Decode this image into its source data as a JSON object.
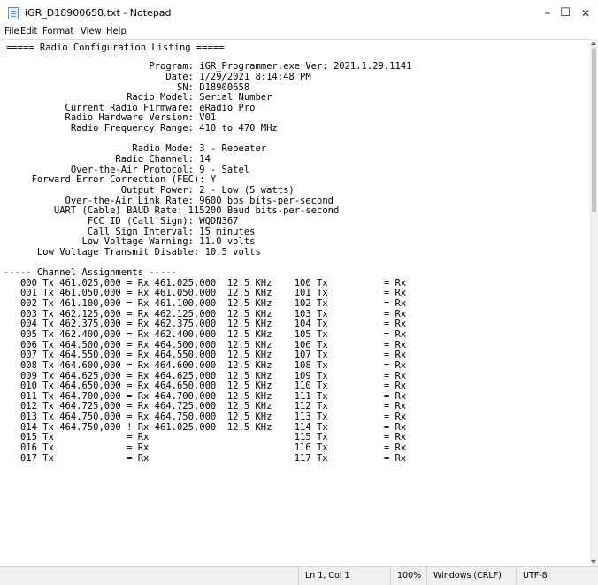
{
  "window": {
    "title": "iGR_D18900658.txt - Notepad",
    "minimize_glyph": "–",
    "maximize_glyph": "☐",
    "close_glyph": "✕"
  },
  "menu": {
    "file": {
      "mnemonic": "F",
      "rest": "ile"
    },
    "edit": {
      "mnemonic": "E",
      "rest": "dit"
    },
    "format_pre": "F",
    "format": {
      "mnemonic": "o",
      "rest": "rmat"
    },
    "view": {
      "mnemonic": "V",
      "rest": "iew"
    },
    "help": {
      "mnemonic": "H",
      "rest": "elp"
    }
  },
  "document": {
    "lines": [
      "===== Radio Configuration Listing =====",
      "",
      "                          Program: iGR_Programmer.exe Ver: 2021.1.29.1141",
      "                             Date: 1/29/2021 8:14:48 PM",
      "                               SN: D18900658",
      "                      Radio Model: Serial Number",
      "           Current Radio Firmware: eRadio Pro",
      "           Radio Hardware Version: V01",
      "            Radio Frequency Range: 410 to 470 MHz",
      "",
      "                       Radio Mode: 3 - Repeater",
      "                    Radio Channel: 14",
      "            Over-the-Air Protocol: 9 - Satel",
      "     Forward Error Correction (FEC): Y",
      "                     Output Power: 2 - Low (5 watts)",
      "           Over-the-Air Link Rate: 9600 bps bits-per-second",
      "         UART (Cable) BAUD Rate: 115200 Baud bits-per-second",
      "               FCC ID (Call Sign): WQDN367",
      "               Call Sign Interval: 15 minutes",
      "              Low Voltage Warning: 11.0 volts",
      "      Low Voltage Transmit Disable: 10.5 volts",
      "",
      "----- Channel Assignments -----",
      "   000 Tx 461.025,000 = Rx 461.025,000  12.5 KHz    100 Tx          = Rx",
      "   001 Tx 461.050,000 = Rx 461.050,000  12.5 KHz    101 Tx          = Rx",
      "   002 Tx 461.100,000 = Rx 461.100,000  12.5 KHz    102 Tx          = Rx",
      "   003 Tx 462.125,000 = Rx 462.125,000  12.5 KHz    103 Tx          = Rx",
      "   004 Tx 462.375,000 = Rx 462.375,000  12.5 KHz    104 Tx          = Rx",
      "   005 Tx 462.400,000 = Rx 462.400,000  12.5 KHz    105 Tx          = Rx",
      "   006 Tx 464.500,000 = Rx 464.500,000  12.5 KHz    106 Tx          = Rx",
      "   007 Tx 464.550,000 = Rx 464.550,000  12.5 KHz    107 Tx          = Rx",
      "   008 Tx 464.600,000 = Rx 464.600,000  12.5 KHz    108 Tx          = Rx",
      "   009 Tx 464.625,000 = Rx 464.625,000  12.5 KHz    109 Tx          = Rx",
      "   010 Tx 464.650,000 = Rx 464.650,000  12.5 KHz    110 Tx          = Rx",
      "   011 Tx 464.700,000 = Rx 464.700,000  12.5 KHz    111 Tx          = Rx",
      "   012 Tx 464.725,000 = Rx 464.725,000  12.5 KHz    112 Tx          = Rx",
      "   013 Tx 464.750,000 = Rx 464.750,000  12.5 KHz    113 Tx          = Rx",
      "   014 Tx 464.750,000 ! Rx 461.025,000  12.5 KHz    114 Tx          = Rx",
      "   015 Tx             = Rx                          115 Tx          = Rx",
      "   016 Tx             = Rx                          116 Tx          = Rx",
      "   017 Tx             = Rx                          117 Tx          = Rx"
    ]
  },
  "status": {
    "position": "Ln 1, Col 1",
    "zoom": "100%",
    "line_ending": "Windows (CRLF)",
    "encoding": "UTF-8"
  },
  "icons": {
    "app": "notepad-icon",
    "scroll_up": "scroll-up-arrow-icon",
    "scroll_down": "scroll-down-arrow-icon"
  }
}
